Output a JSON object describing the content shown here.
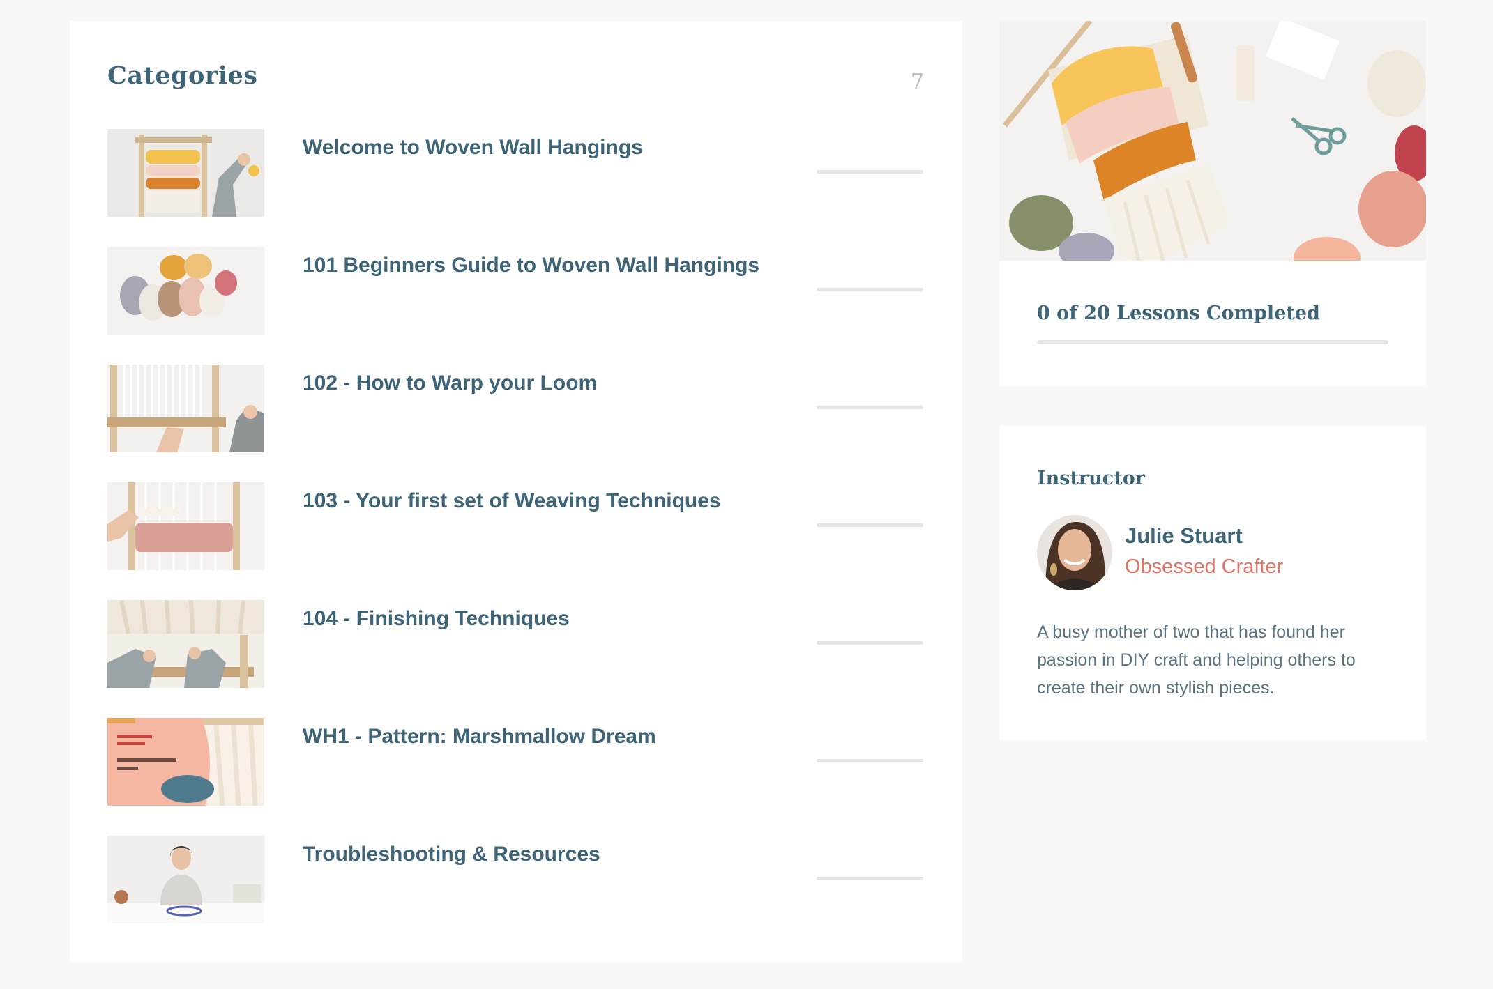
{
  "categories": {
    "title": "Categories",
    "count": "7",
    "items": [
      {
        "label": "Welcome to Woven Wall Hangings",
        "progress": 0
      },
      {
        "label": "101 Beginners Guide to Woven Wall Hangings",
        "progress": 0
      },
      {
        "label": "102 - How to Warp your Loom",
        "progress": 0
      },
      {
        "label": "103 - Your first set of Weaving Techniques",
        "progress": 0
      },
      {
        "label": "104 - Finishing Techniques",
        "progress": 0
      },
      {
        "label": "WH1 - Pattern: Marshmallow Dream",
        "progress": 0
      },
      {
        "label": "Troubleshooting & Resources",
        "progress": 0
      }
    ]
  },
  "course": {
    "lessons_completed": "0 of 20 Lessons Completed",
    "completed_fraction": 0
  },
  "instructor": {
    "heading": "Instructor",
    "name": "Julie Stuart",
    "role": "Obsessed Crafter",
    "bio": "A busy mother of two that has found her passion in DIY craft and helping others to create their own stylish pieces."
  },
  "colors": {
    "heading": "#3d6477",
    "accent": "#e07566",
    "track": "#e4e4e4",
    "page_bg": "#f8f8f8"
  }
}
